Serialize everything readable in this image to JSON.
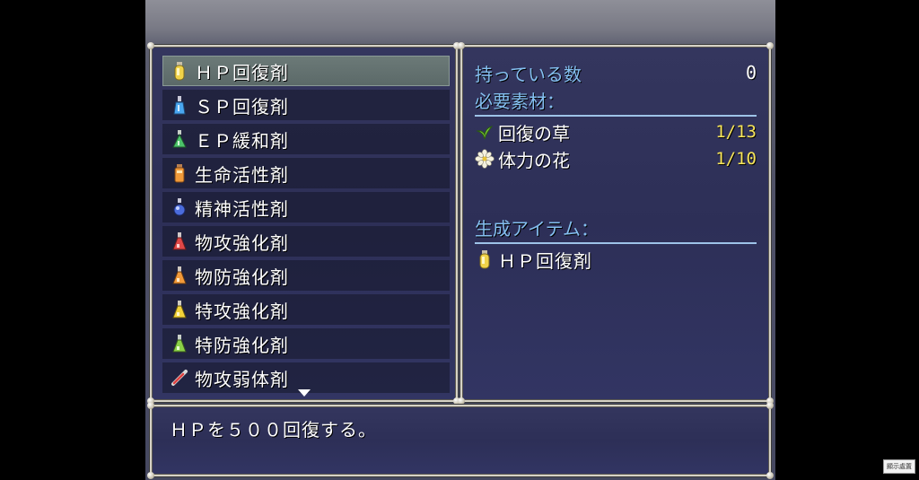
{
  "items": [
    {
      "label": "ＨＰ回復剤",
      "icon": "yellow-potion-icon",
      "selected": true
    },
    {
      "label": "ＳＰ回復剤",
      "icon": "blue-potion-icon"
    },
    {
      "label": "ＥＰ緩和剤",
      "icon": "green-potion-icon"
    },
    {
      "label": "生命活性剤",
      "icon": "orange-bottle-icon"
    },
    {
      "label": "精神活性剤",
      "icon": "blue-bottle-icon"
    },
    {
      "label": "物攻強化剤",
      "icon": "red-flask-icon"
    },
    {
      "label": "物防強化剤",
      "icon": "orange-flask-icon"
    },
    {
      "label": "特攻強化剤",
      "icon": "yellow-flask-icon"
    },
    {
      "label": "特防強化剤",
      "icon": "green-flask-icon"
    },
    {
      "label": "物攻弱体剤",
      "icon": "red-syringe-icon"
    }
  ],
  "detail": {
    "owned_label": "持っている数",
    "owned_value": "0",
    "materials_heading": "必要素材：",
    "materials": [
      {
        "name": "回復の草",
        "count": "1/13",
        "icon": "herb-icon"
      },
      {
        "name": "体力の花",
        "count": "1/10",
        "icon": "flower-icon"
      }
    ],
    "result_heading": "生成アイテム：",
    "result_item": "ＨＰ回復剤",
    "result_icon": "yellow-potion-icon"
  },
  "help": {
    "text": "ＨＰを５００回復する。"
  },
  "overlay_button": "顯示處置",
  "colors": {
    "window_bg": "#2f315a",
    "selection": "#65736f",
    "label_blue": "#84bff0",
    "count_yellow": "#f7e55a"
  }
}
